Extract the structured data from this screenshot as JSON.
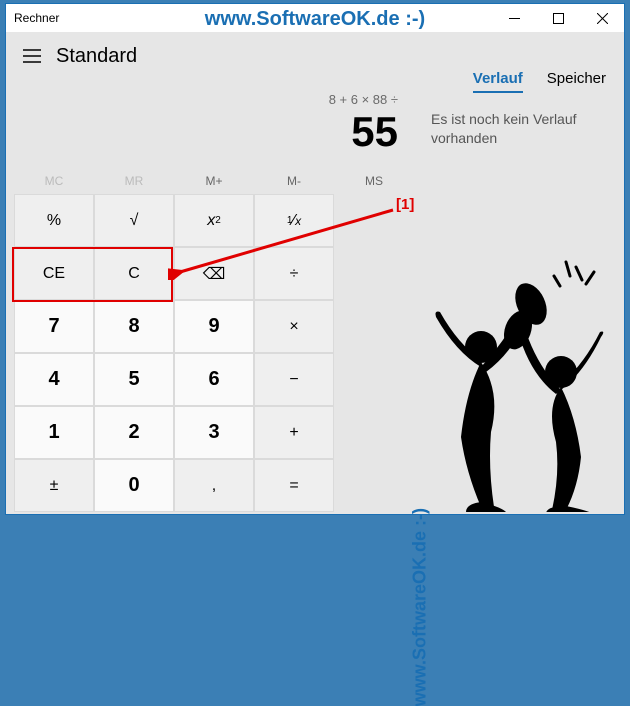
{
  "window": {
    "title": "Rechner",
    "watermark_top": "www.SoftwareOK.de :-)",
    "watermark_side": "www.SoftwareOK.de :-)"
  },
  "header": {
    "mode": "Standard"
  },
  "tabs": {
    "history": "Verlauf",
    "memory": "Speicher"
  },
  "display": {
    "expression": "8 + 6 × 88 ÷",
    "result": "55"
  },
  "history_panel": {
    "empty_text": "Es ist noch kein Verlauf vorhanden"
  },
  "memory_row": {
    "mc": "MC",
    "mr": "MR",
    "mplus": "M+",
    "mminus": "M-",
    "ms": "MS"
  },
  "keys": {
    "percent": "%",
    "sqrt": "√",
    "square": "x²",
    "recip": "¹∕ₓ",
    "ce": "CE",
    "c": "C",
    "back": "⌫",
    "div": "÷",
    "d7": "7",
    "d8": "8",
    "d9": "9",
    "mul": "×",
    "d4": "4",
    "d5": "5",
    "d6": "6",
    "sub": "−",
    "d1": "1",
    "d2": "2",
    "d3": "3",
    "add": "+",
    "sign": "±",
    "d0": "0",
    "dec": ",",
    "eq": "="
  },
  "callout": {
    "label": "[1]"
  }
}
